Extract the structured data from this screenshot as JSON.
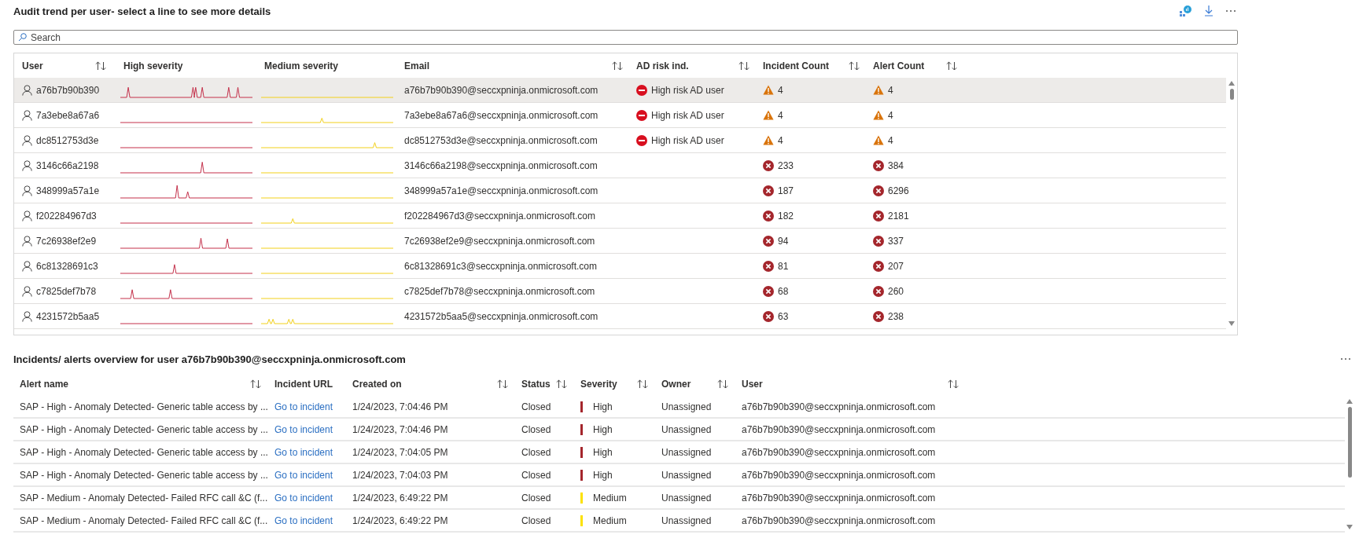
{
  "title": "Audit trend per user- select a line to see more details",
  "search": {
    "placeholder": "Search"
  },
  "user_table": {
    "columns": [
      {
        "label": "User",
        "sortable": true
      },
      {
        "label": "High severity",
        "sortable": false
      },
      {
        "label": "Medium severity",
        "sortable": false
      },
      {
        "label": "Email",
        "sortable": true
      },
      {
        "label": "AD risk ind.",
        "sortable": true
      },
      {
        "label": "Incident Count",
        "sortable": true
      },
      {
        "label": "Alert Count",
        "sortable": true
      }
    ],
    "rows": [
      {
        "user": "a76b7b90b390",
        "email": "a76b7b90b390@seccxpninja.onmicrosoft.com",
        "ad_risk": "High risk AD user",
        "incident": {
          "kind": "warning",
          "count": "4"
        },
        "alert": {
          "kind": "warning",
          "count": "4"
        },
        "selected": true
      },
      {
        "user": "7a3ebe8a67a6",
        "email": "7a3ebe8a67a6@seccxpninja.onmicrosoft.com",
        "ad_risk": "High risk AD user",
        "incident": {
          "kind": "warning",
          "count": "4"
        },
        "alert": {
          "kind": "warning",
          "count": "4"
        },
        "selected": false
      },
      {
        "user": "dc8512753d3e",
        "email": "dc8512753d3e@seccxpninja.onmicrosoft.com",
        "ad_risk": "High risk AD user",
        "incident": {
          "kind": "warning",
          "count": "4"
        },
        "alert": {
          "kind": "warning",
          "count": "4"
        },
        "selected": false
      },
      {
        "user": "3146c66a2198",
        "email": "3146c66a2198@seccxpninja.onmicrosoft.com",
        "incident": {
          "kind": "error",
          "count": "233"
        },
        "alert": {
          "kind": "error",
          "count": "384"
        },
        "selected": false
      },
      {
        "user": "348999a57a1e",
        "email": "348999a57a1e@seccxpninja.onmicrosoft.com",
        "incident": {
          "kind": "error",
          "count": "187"
        },
        "alert": {
          "kind": "error",
          "count": "6296"
        },
        "selected": false
      },
      {
        "user": "f202284967d3",
        "email": "f202284967d3@seccxpninja.onmicrosoft.com",
        "incident": {
          "kind": "error",
          "count": "182"
        },
        "alert": {
          "kind": "error",
          "count": "2181"
        },
        "selected": false
      },
      {
        "user": "7c26938ef2e9",
        "email": "7c26938ef2e9@seccxpninja.onmicrosoft.com",
        "incident": {
          "kind": "error",
          "count": "94"
        },
        "alert": {
          "kind": "error",
          "count": "337"
        },
        "selected": false
      },
      {
        "user": "6c81328691c3",
        "email": "6c81328691c3@seccxpninja.onmicrosoft.com",
        "incident": {
          "kind": "error",
          "count": "81"
        },
        "alert": {
          "kind": "error",
          "count": "207"
        },
        "selected": false
      },
      {
        "user": "c7825def7b78",
        "email": "c7825def7b78@seccxpninja.onmicrosoft.com",
        "incident": {
          "kind": "error",
          "count": "68"
        },
        "alert": {
          "kind": "error",
          "count": "260"
        },
        "selected": false
      },
      {
        "user": "4231572b5aa5",
        "email": "4231572b5aa5@seccxpninja.onmicrosoft.com",
        "incident": {
          "kind": "error",
          "count": "63"
        },
        "alert": {
          "kind": "error",
          "count": "238"
        },
        "selected": false
      }
    ]
  },
  "alerts_title": "Incidents/ alerts overview for user a76b7b90b390@seccxpninja.onmicrosoft.com",
  "alerts_table": {
    "columns": [
      {
        "label": "Alert name",
        "sortable": true
      },
      {
        "label": "Incident URL",
        "sortable": false
      },
      {
        "label": "Created on",
        "sortable": true
      },
      {
        "label": "Status",
        "sortable": true
      },
      {
        "label": "Severity",
        "sortable": true
      },
      {
        "label": "Owner",
        "sortable": true
      },
      {
        "label": "User",
        "sortable": true
      }
    ],
    "rows": [
      {
        "alert_name": "SAP - High - Anomaly Detected- Generic table access by ...",
        "incident_url": "Go to incident",
        "created_on": "1/24/2023, 7:04:46 PM",
        "status": "Closed",
        "severity": {
          "label": "High",
          "color": "#a4262c"
        },
        "owner": "Unassigned",
        "user": "a76b7b90b390@seccxpninja.onmicrosoft.com"
      },
      {
        "alert_name": "SAP - High - Anomaly Detected- Generic table access by ...",
        "incident_url": "Go to incident",
        "created_on": "1/24/2023, 7:04:46 PM",
        "status": "Closed",
        "severity": {
          "label": "High",
          "color": "#a4262c"
        },
        "owner": "Unassigned",
        "user": "a76b7b90b390@seccxpninja.onmicrosoft.com"
      },
      {
        "alert_name": "SAP - High - Anomaly Detected- Generic table access by ...",
        "incident_url": "Go to incident",
        "created_on": "1/24/2023, 7:04:05 PM",
        "status": "Closed",
        "severity": {
          "label": "High",
          "color": "#a4262c"
        },
        "owner": "Unassigned",
        "user": "a76b7b90b390@seccxpninja.onmicrosoft.com"
      },
      {
        "alert_name": "SAP - High - Anomaly Detected- Generic table access by ...",
        "incident_url": "Go to incident",
        "created_on": "1/24/2023, 7:04:03 PM",
        "status": "Closed",
        "severity": {
          "label": "High",
          "color": "#a4262c"
        },
        "owner": "Unassigned",
        "user": "a76b7b90b390@seccxpninja.onmicrosoft.com"
      },
      {
        "alert_name": "SAP - Medium - Anomaly Detected- Failed RFC call &C (f...",
        "incident_url": "Go to incident",
        "created_on": "1/24/2023, 6:49:22 PM",
        "status": "Closed",
        "severity": {
          "label": "Medium",
          "color": "#fce100"
        },
        "owner": "Unassigned",
        "user": "a76b7b90b390@seccxpninja.onmicrosoft.com"
      },
      {
        "alert_name": "SAP - Medium - Anomaly Detected- Failed RFC call &C (f...",
        "incident_url": "Go to incident",
        "created_on": "1/24/2023, 6:49:22 PM",
        "status": "Closed",
        "severity": {
          "label": "Medium",
          "color": "#fce100"
        },
        "owner": "Unassigned",
        "user": "a76b7b90b390@seccxpninja.onmicrosoft.com"
      }
    ]
  }
}
